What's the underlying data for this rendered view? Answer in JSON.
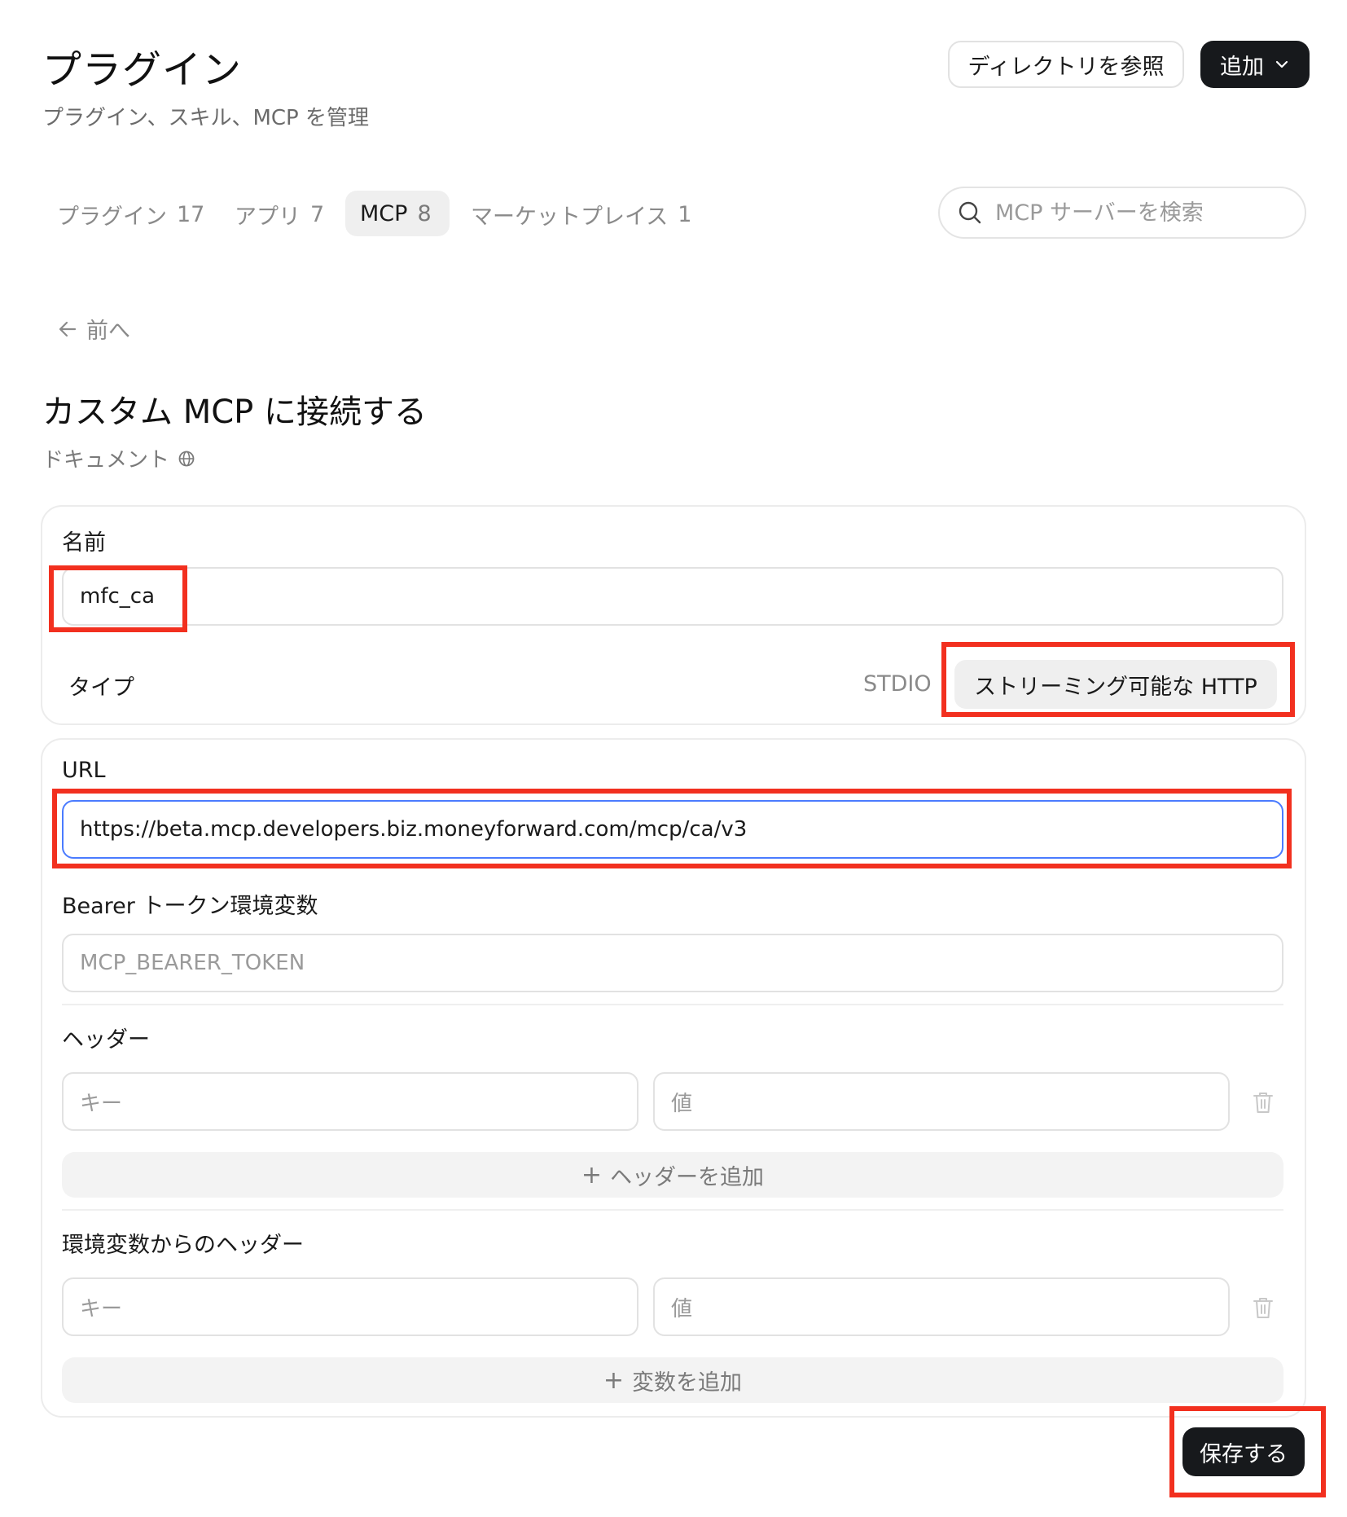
{
  "header": {
    "title": "プラグイン",
    "subtitle": "プラグイン、スキル、MCP を管理",
    "browse_label": "ディレクトリを参照",
    "add_label": "追加"
  },
  "tabs": [
    {
      "label": "プラグイン",
      "count": "17"
    },
    {
      "label": "アプリ",
      "count": "7"
    },
    {
      "label": "MCP",
      "count": "8"
    },
    {
      "label": "マーケットプレイス",
      "count": "1"
    }
  ],
  "search": {
    "placeholder": "MCP サーバーを検索"
  },
  "back_label": "前へ",
  "form": {
    "title": "カスタム MCP に接続する",
    "docs_label": "ドキュメント",
    "name_label": "名前",
    "name_value": "mfc_ca",
    "type_label": "タイプ",
    "type_stdio": "STDIO",
    "type_http": "ストリーミング可能な HTTP",
    "url_label": "URL",
    "url_value": "https://beta.mcp.developers.biz.moneyforward.com/mcp/ca/v3",
    "bearer_label": "Bearer トークン環境変数",
    "bearer_placeholder": "MCP_BEARER_TOKEN",
    "headers_label": "ヘッダー",
    "key_placeholder": "キー",
    "value_placeholder": "値",
    "add_header_label": "ヘッダーを追加",
    "env_headers_label": "環境変数からのヘッダー",
    "add_variable_label": "変数を追加",
    "save_label": "保存する"
  },
  "colors": {
    "highlight": "#f2301f",
    "dark_button": "#17191c",
    "focus_border": "#4a7bff"
  }
}
